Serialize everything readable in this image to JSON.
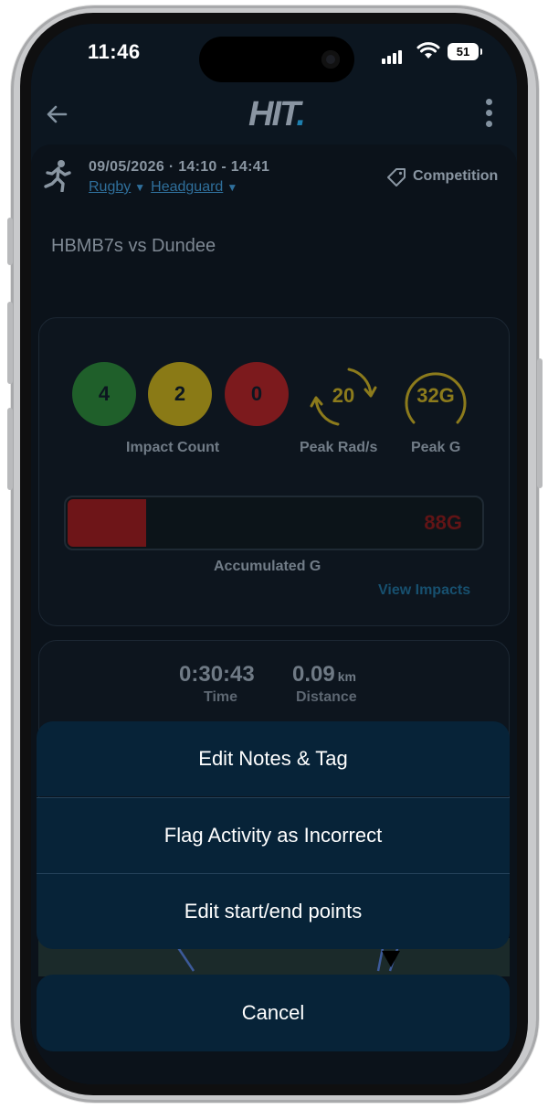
{
  "status_bar": {
    "time": "11:46",
    "battery": "51"
  },
  "header": {
    "logo_text": "HIT",
    "logo_dot": "."
  },
  "activity": {
    "datetime": "09/05/2026 · 14:10 - 14:41",
    "sport": "Rugby",
    "device": "Headguard",
    "tag": "Competition",
    "title": "HBMB7s vs Dundee"
  },
  "impacts": {
    "green_count": "4",
    "yellow_count": "2",
    "red_count": "0",
    "count_label": "Impact Count",
    "peak_rad": "20",
    "peak_rad_label": "Peak Rad/s",
    "peak_g": "32G",
    "peak_g_label": "Peak G",
    "accumulated_value": "88G",
    "accumulated_fraction": 0.19,
    "accumulated_label": "Accumulated G",
    "view_impacts": "View Impacts"
  },
  "stats": {
    "time_value": "0:30:43",
    "time_label": "Time",
    "distance_value": "0.09",
    "distance_unit": "km",
    "distance_label": "Distance"
  },
  "action_sheet": {
    "edit_notes": "Edit Notes & Tag",
    "flag": "Flag Activity as Incorrect",
    "edit_points": "Edit start/end points",
    "cancel": "Cancel"
  },
  "colors": {
    "sheet_bg": "#072338",
    "impact_green": "#1f5f2a",
    "impact_yellow": "#8a7a16",
    "impact_red": "#7c1a1d",
    "link_blue": "#2f6f9b"
  }
}
